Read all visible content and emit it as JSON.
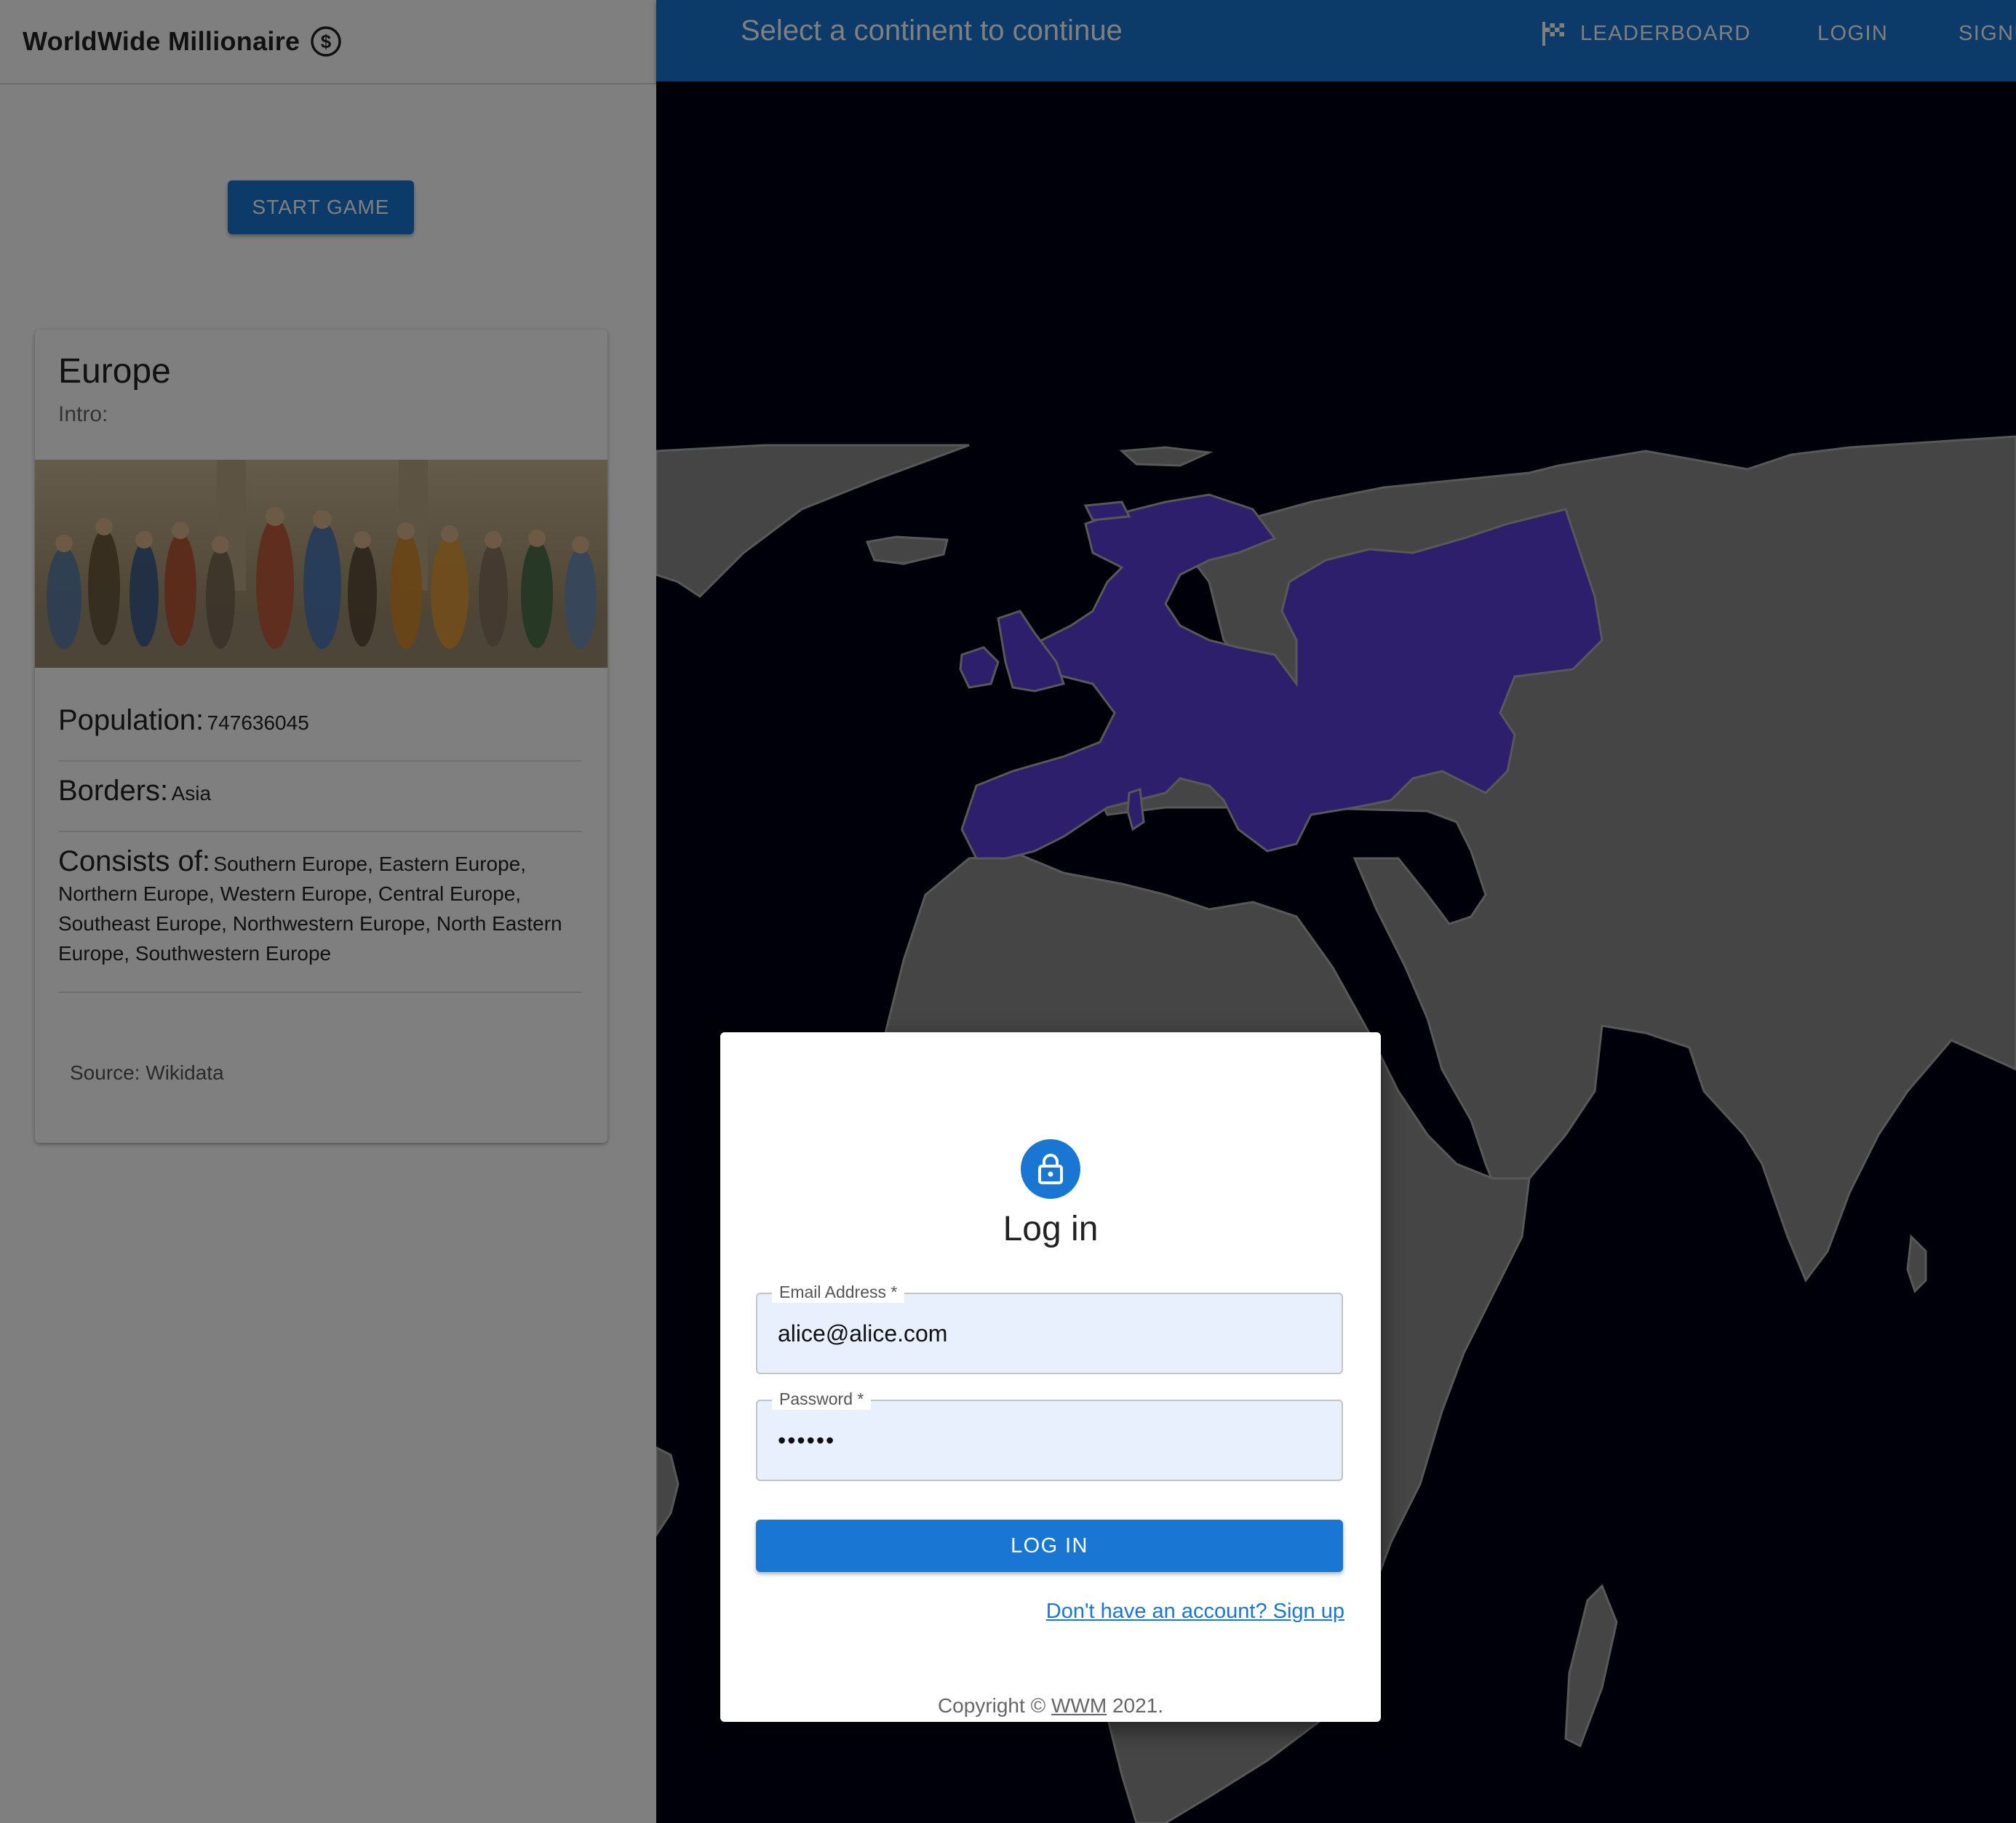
{
  "app": {
    "title": "WorldWide Millionaire"
  },
  "sidebar": {
    "start_button": "START GAME",
    "card": {
      "title": "Europe",
      "subtitle": "Intro:",
      "population_label": "Population:",
      "population_value": "747636045",
      "borders_label": "Borders:",
      "borders_value": "Asia",
      "consists_label": "Consists of:",
      "consists_value": "Southern Europe, Eastern Europe, Northern Europe, Western Europe, Central Europe, Southeast Europe, Northwestern Europe, North Eastern Europe, Southwestern Europe",
      "source": "Source: Wikidata"
    }
  },
  "topbar": {
    "title": "Select a continent to continue",
    "nav": {
      "leaderboard": "LEADERBOARD",
      "login": "LOGIN",
      "signup": "SIGNUP"
    }
  },
  "map": {
    "highlighted_continent": "Europe",
    "colors": {
      "ocean": "#000014",
      "land": "#8a8a8a",
      "highlight": "#5b3fd6",
      "appbar": "#1976d2"
    }
  },
  "dialog": {
    "title": "Log in",
    "email_label": "Email Address *",
    "email_value": "alice@alice.com",
    "password_label": "Password *",
    "password_value": "••••••",
    "login_button": "LOG IN",
    "signup_link": "Don't have an account? Sign up",
    "copyright_prefix": "Copyright ©",
    "copyright_link": "WWM",
    "copyright_suffix": "2021."
  }
}
